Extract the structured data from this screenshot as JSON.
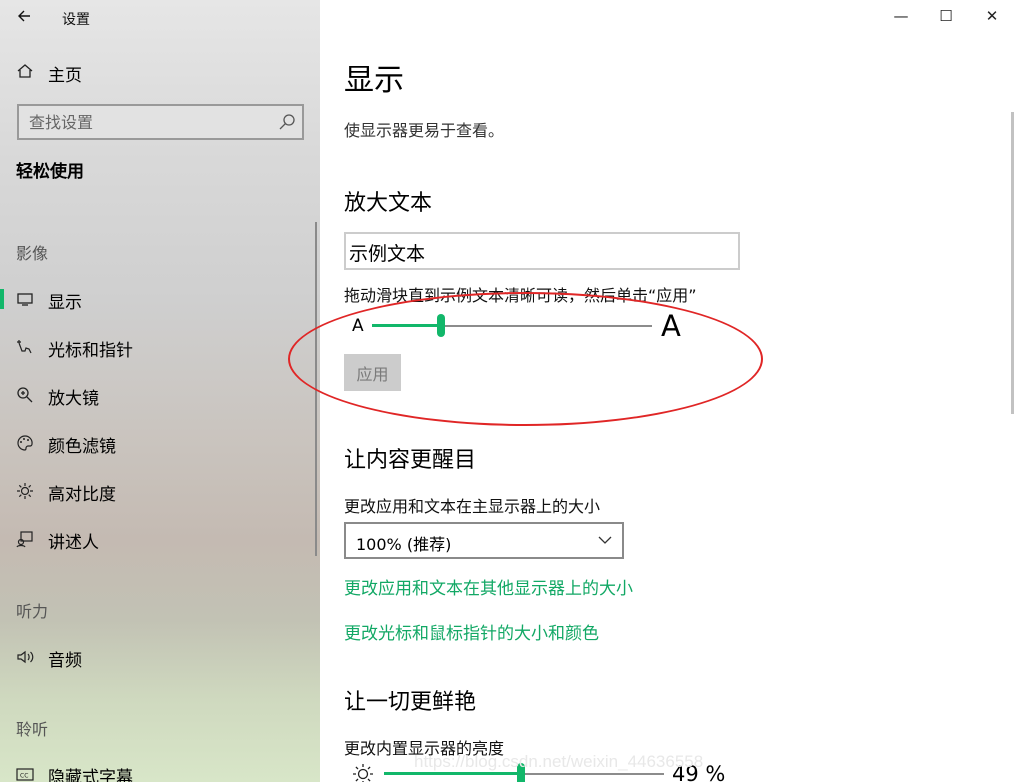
{
  "window": {
    "title": "设置",
    "minimize": "—",
    "maximize": "☐",
    "close": "✕"
  },
  "sidebar": {
    "home": "主页",
    "search_placeholder": "查找设置",
    "section": "轻松使用",
    "groups": [
      {
        "label": "影像",
        "items": [
          "显示",
          "光标和指针",
          "放大镜",
          "颜色滤镜",
          "高对比度",
          "讲述人"
        ]
      },
      {
        "label": "听力",
        "items": [
          "音频",
          "隐藏式字幕"
        ]
      },
      {
        "label": "聆听"
      }
    ],
    "active_item": "显示"
  },
  "main": {
    "title": "显示",
    "subtitle": "使显示器更易于查看。",
    "enlarge_text": {
      "heading": "放大文本",
      "sample": "示例文本",
      "instruction": "拖动滑块直到示例文本清晰可读，然后单击“应用”",
      "small_glyph": "A",
      "large_glyph": "A",
      "slider_fraction": 0.24,
      "apply_label": "应用"
    },
    "bigger": {
      "heading": "让内容更醒目",
      "label": "更改应用和文本在主显示器上的大小",
      "select_value": "100% (推荐)",
      "link1": "更改应用和文本在其他显示器上的大小",
      "link2": "更改光标和鼠标指针的大小和颜色"
    },
    "brighter": {
      "heading": "让一切更鲜艳",
      "label": "更改内置显示器的亮度",
      "brightness_value": "49 %",
      "brightness_fraction": 0.49
    }
  },
  "watermark": "https://blog.csdn.net/weixin_44636558",
  "colors": {
    "accent": "#12b76a",
    "link": "#12a865",
    "highlight": "#e02626"
  }
}
